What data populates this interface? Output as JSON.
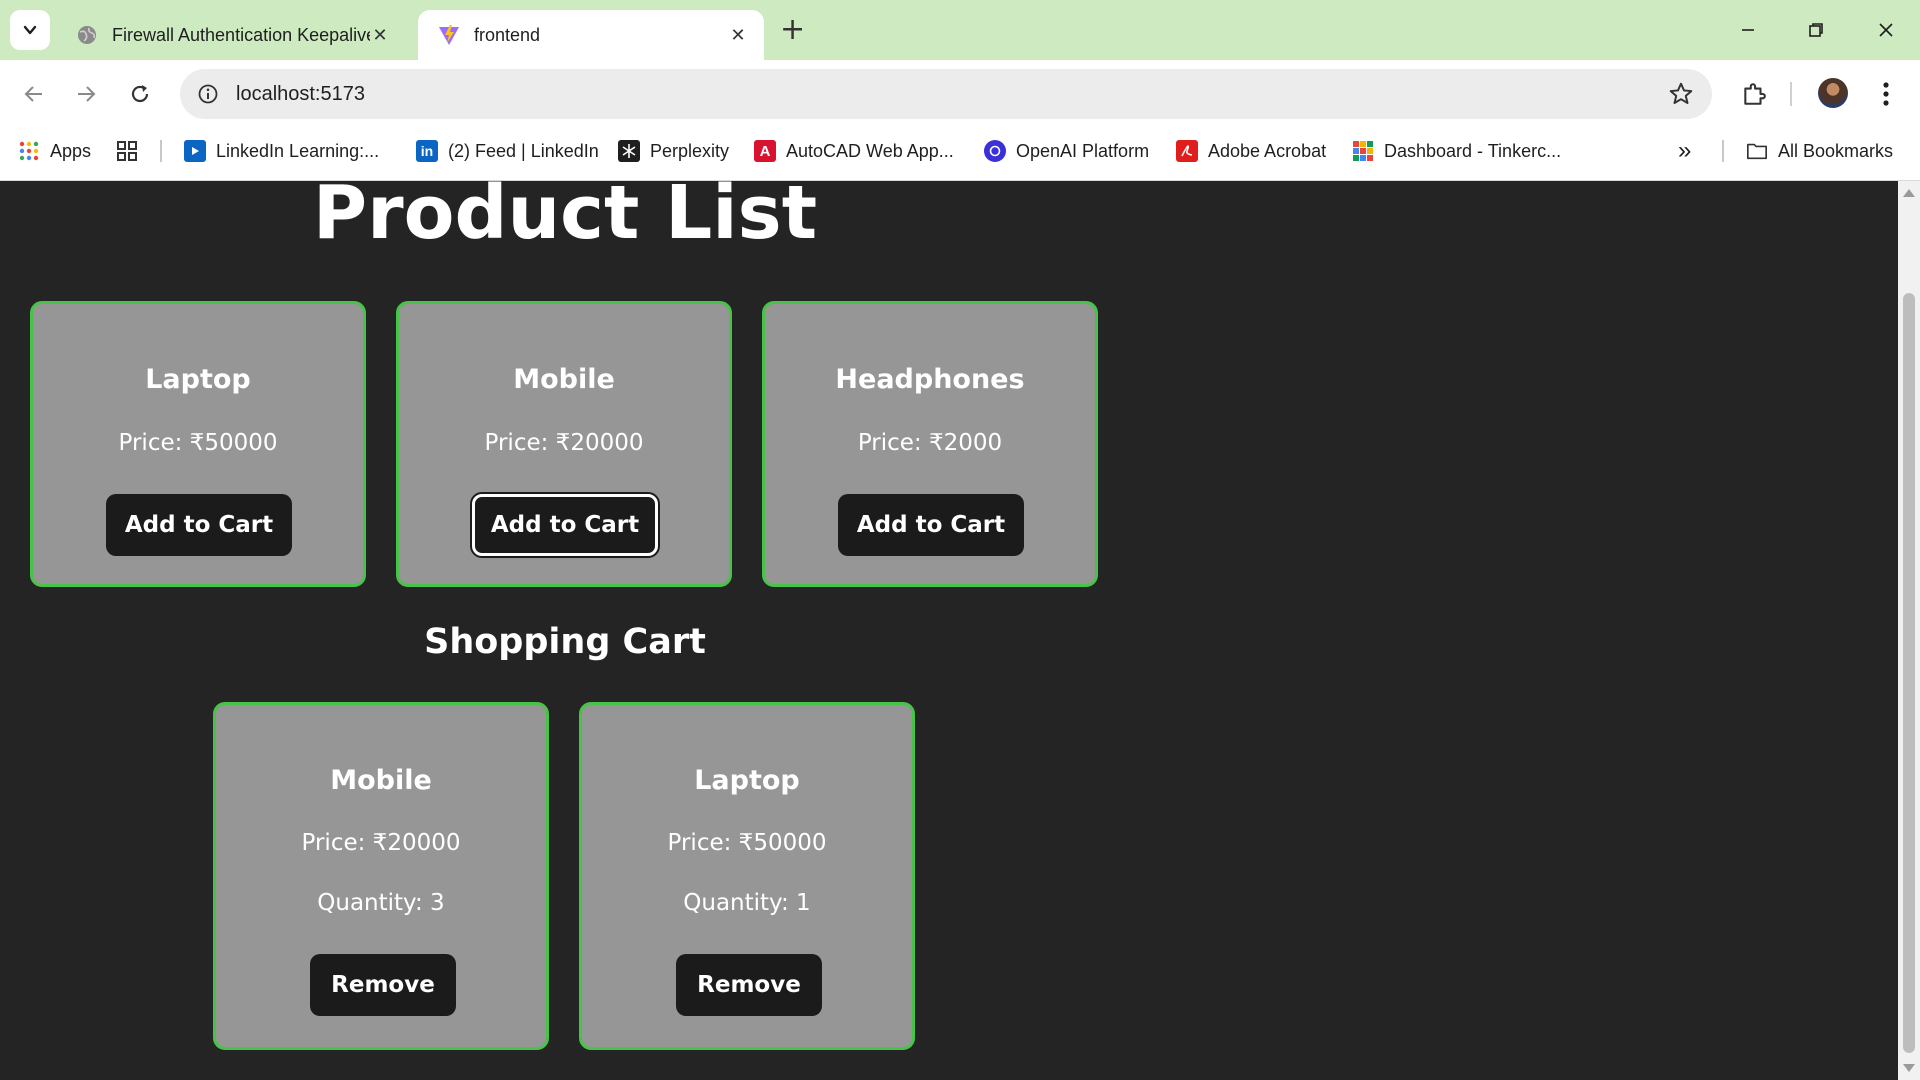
{
  "browser": {
    "tabs": [
      {
        "title": "Firewall Authentication Keepalive",
        "favicon": "globe-icon",
        "active": false
      },
      {
        "title": "frontend",
        "favicon": "vite-logo-icon",
        "active": true
      }
    ],
    "address": "localhost:5173"
  },
  "bookmarks": {
    "apps_label": "Apps",
    "items": [
      {
        "label": "LinkedIn Learning:...",
        "icon": "linkedin-learning-icon"
      },
      {
        "label": "(2) Feed | LinkedIn",
        "icon": "linkedin-icon"
      },
      {
        "label": "Perplexity",
        "icon": "perplexity-icon"
      },
      {
        "label": "AutoCAD Web App...",
        "icon": "autocad-icon"
      },
      {
        "label": "OpenAI Platform",
        "icon": "openai-icon"
      },
      {
        "label": "Adobe Acrobat",
        "icon": "acrobat-icon"
      },
      {
        "label": "Dashboard - Tinkerc...",
        "icon": "tinkercad-icon"
      }
    ],
    "overflow_label": "»",
    "all_bookmarks_label": "All Bookmarks"
  },
  "page": {
    "title": "Product List",
    "products": [
      {
        "name": "Laptop",
        "price": "Price: ₹50000",
        "button": "Add to Cart"
      },
      {
        "name": "Mobile",
        "price": "Price: ₹20000",
        "button": "Add to Cart"
      },
      {
        "name": "Headphones",
        "price": "Price: ₹2000",
        "button": "Add to Cart"
      }
    ],
    "cart_title": "Shopping Cart",
    "cart": [
      {
        "name": "Mobile",
        "price": "Price: ₹20000",
        "quantity": "Quantity: 3",
        "button": "Remove"
      },
      {
        "name": "Laptop",
        "price": "Price: ₹50000",
        "quantity": "Quantity: 1",
        "button": "Remove"
      }
    ]
  },
  "colors": {
    "page_background": "#242424",
    "card_background": "#969696",
    "card_border": "#47c447",
    "button_background": "#1b1b1b",
    "tabstrip": "#cdeac0"
  }
}
